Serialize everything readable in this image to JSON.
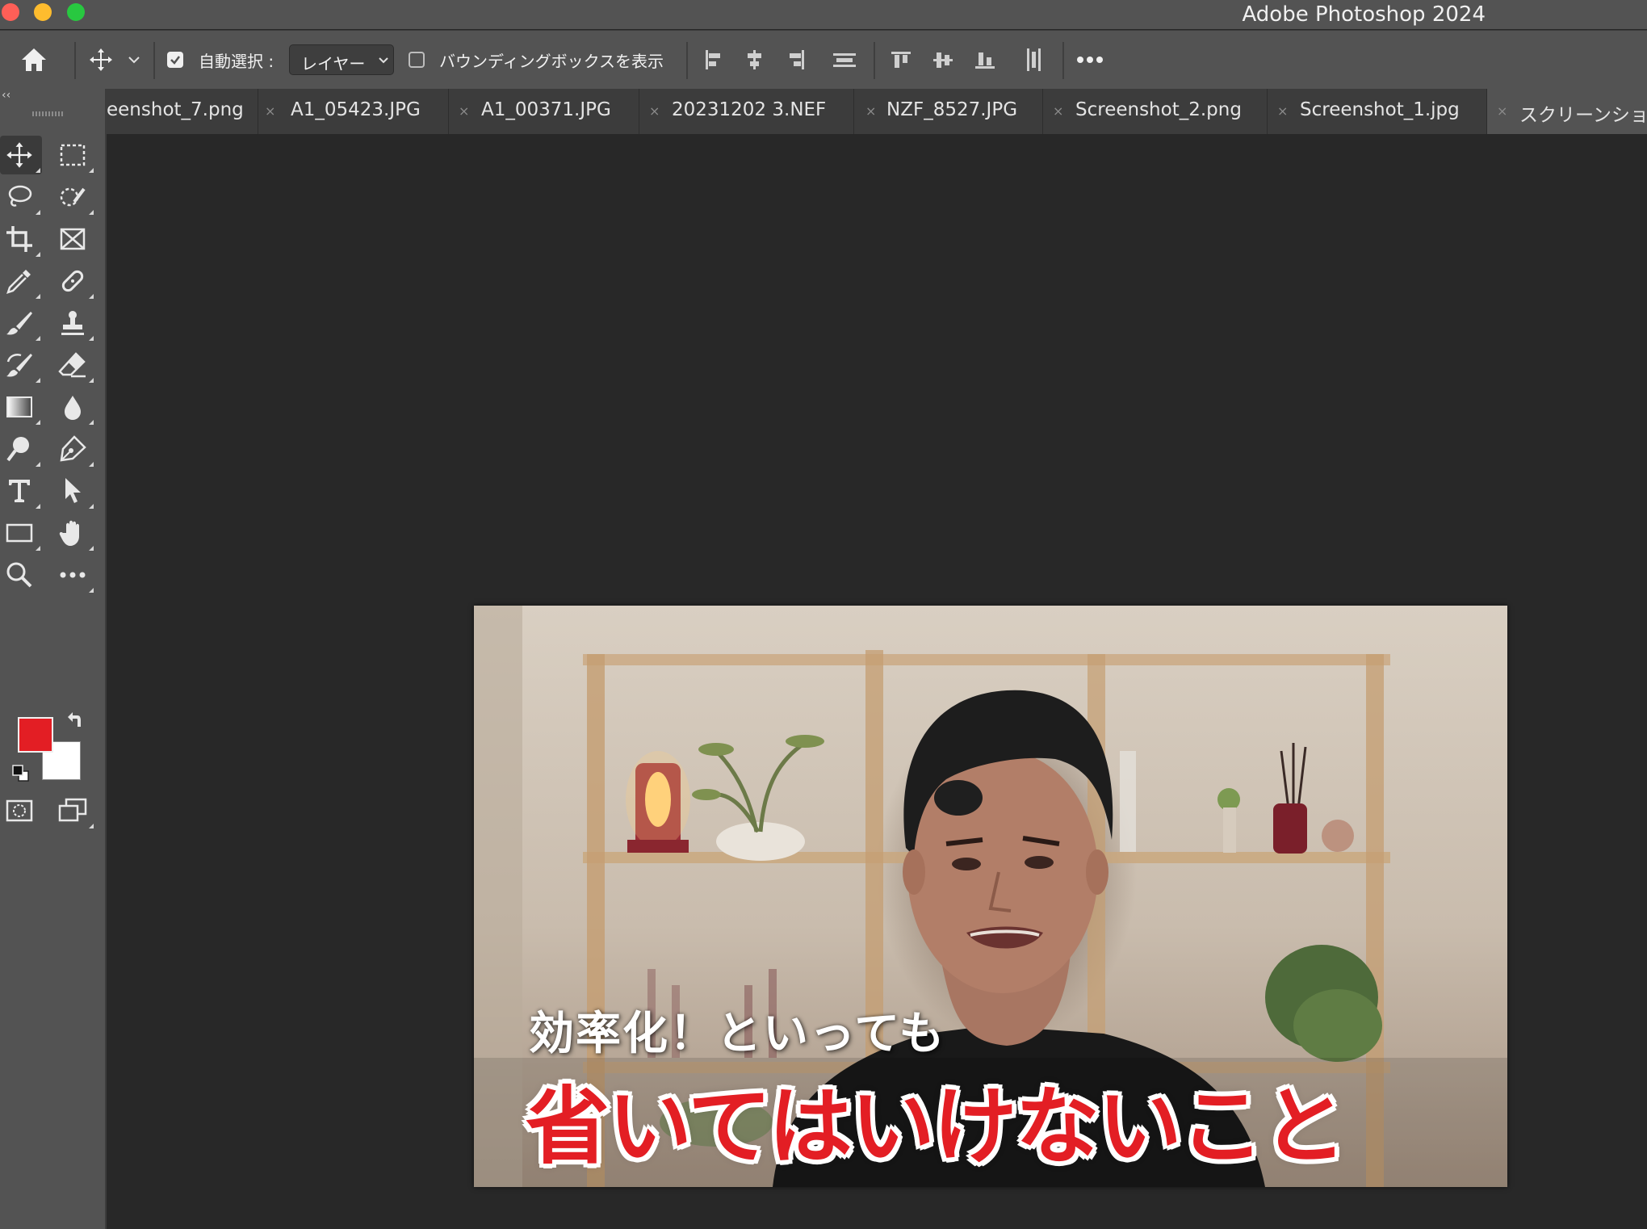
{
  "window": {
    "title": "Adobe Photoshop 2024"
  },
  "options_bar": {
    "auto_select_label": "自動選択 :",
    "auto_select_checked": true,
    "auto_select_target": "レイヤー",
    "bounding_box_label": "バウンディングボックスを表示",
    "bounding_box_checked": false
  },
  "panel_collapse": "‹‹",
  "tabs": [
    {
      "label": "eenshot_7.png",
      "active": false
    },
    {
      "label": "A1_05423.JPG",
      "active": false
    },
    {
      "label": "A1_00371.JPG",
      "active": false
    },
    {
      "label": "20231202 3.NEF",
      "active": false
    },
    {
      "label": "NZF_8527.JPG",
      "active": false
    },
    {
      "label": "Screenshot_2.png",
      "active": false
    },
    {
      "label": "Screenshot_1.jpg",
      "active": false
    },
    {
      "label": "スクリーンショ",
      "active": true
    }
  ],
  "tab_close_glyph": "×",
  "colors": {
    "foreground": "#e31e24",
    "background": "#ffffff"
  },
  "document": {
    "caption_sub": "効率化！といっても",
    "caption_main": "省いてはいけないこと"
  }
}
